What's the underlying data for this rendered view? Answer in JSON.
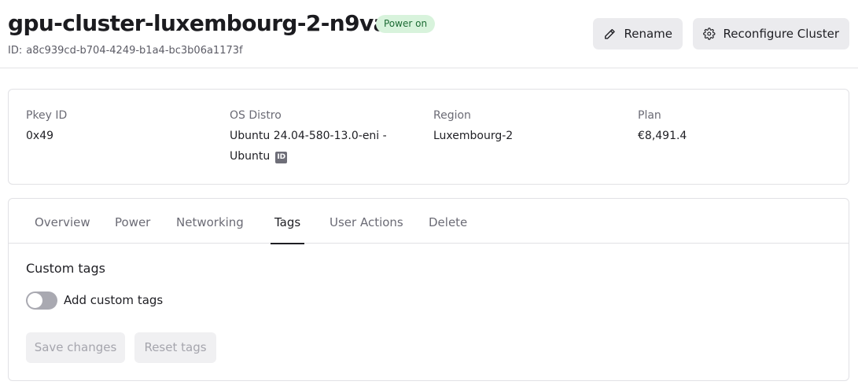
{
  "header": {
    "title": "gpu-cluster-luxembourg-2-n9vam",
    "status_badge": "Power on",
    "id_label": "ID:",
    "id_value": "a8c939cd-b704-4249-b1a4-bc3b06a1173f",
    "rename_label": "Rename",
    "reconfigure_label": "Reconfigure Cluster"
  },
  "info": {
    "pkey": {
      "label": "Pkey ID",
      "value": "0x49"
    },
    "os": {
      "label": "OS Distro",
      "value_line1": "Ubuntu 24.04-580-13.0-eni -",
      "value_line2": "Ubuntu",
      "chip": "ID"
    },
    "region": {
      "label": "Region",
      "value": "Luxembourg-2"
    },
    "plan": {
      "label": "Plan",
      "value": "€8,491.4"
    }
  },
  "tabs": [
    {
      "label": "Overview",
      "active": false
    },
    {
      "label": "Power",
      "active": false
    },
    {
      "label": "Networking",
      "active": false
    },
    {
      "label": "Tags",
      "active": true
    },
    {
      "label": "User Actions",
      "active": false
    },
    {
      "label": "Delete",
      "active": false
    }
  ],
  "tags_panel": {
    "title": "Custom tags",
    "toggle_label": "Add custom tags",
    "toggle_on": false,
    "save_label": "Save changes",
    "reset_label": "Reset tags"
  },
  "colors": {
    "badge_bg": "#d8f3dc",
    "badge_text": "#1c6b34",
    "button_bg": "#ebebee",
    "disabled_text": "#a5a5ad"
  },
  "icons": [
    "pencil-icon",
    "gear-icon",
    "id-icon"
  ]
}
